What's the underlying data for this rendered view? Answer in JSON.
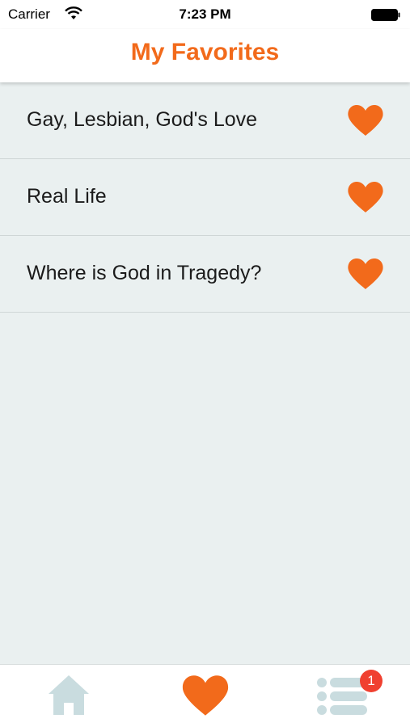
{
  "status": {
    "carrier": "Carrier",
    "time": "7:23 PM"
  },
  "nav": {
    "title": "My Favorites"
  },
  "favorites": [
    {
      "label": "Gay, Lesbian, God's Love"
    },
    {
      "label": "Real Life"
    },
    {
      "label": "Where is God in Tragedy?"
    }
  ],
  "tabs": {
    "home_icon": "house-icon",
    "favorites_icon": "heart-icon",
    "list_icon": "list-icon",
    "list_badge": "1"
  },
  "colors": {
    "accent": "#f26a1b",
    "background": "#eaf0f0",
    "tab_inactive": "#c9dcdf",
    "badge": "#f04030"
  }
}
